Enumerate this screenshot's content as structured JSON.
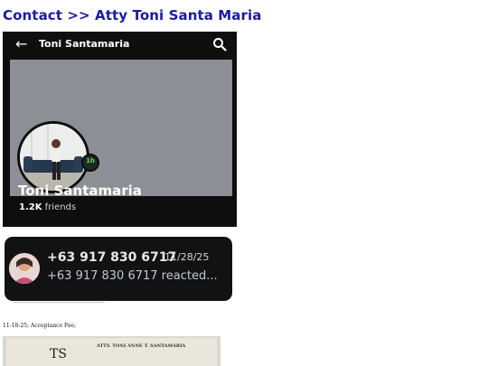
{
  "page": {
    "title": "Contact >> Atty Toni Santa Maria"
  },
  "profile": {
    "header_name": "Toni Santamaria",
    "name": "Toni Santamaria",
    "friends_count": "1.2K",
    "friends_label": "friends",
    "active_badge": "1h",
    "icons": [
      "back-arrow-icon",
      "search-icon"
    ]
  },
  "notification": {
    "phone": "+63 917 830 6717",
    "date": "11/28/25",
    "message": "+63 917 830 6717 reacted..."
  },
  "caption": "11-18-25; Acceptance Fee;",
  "document": {
    "logo": "TS",
    "header": "ATTY. TONI ANNE T. SANTAMARIA"
  },
  "colors": {
    "title": "#1a1aa6",
    "profile_bg": "#0e0e0e",
    "cover": "#8d8f96",
    "notification_bg": "#111214"
  }
}
